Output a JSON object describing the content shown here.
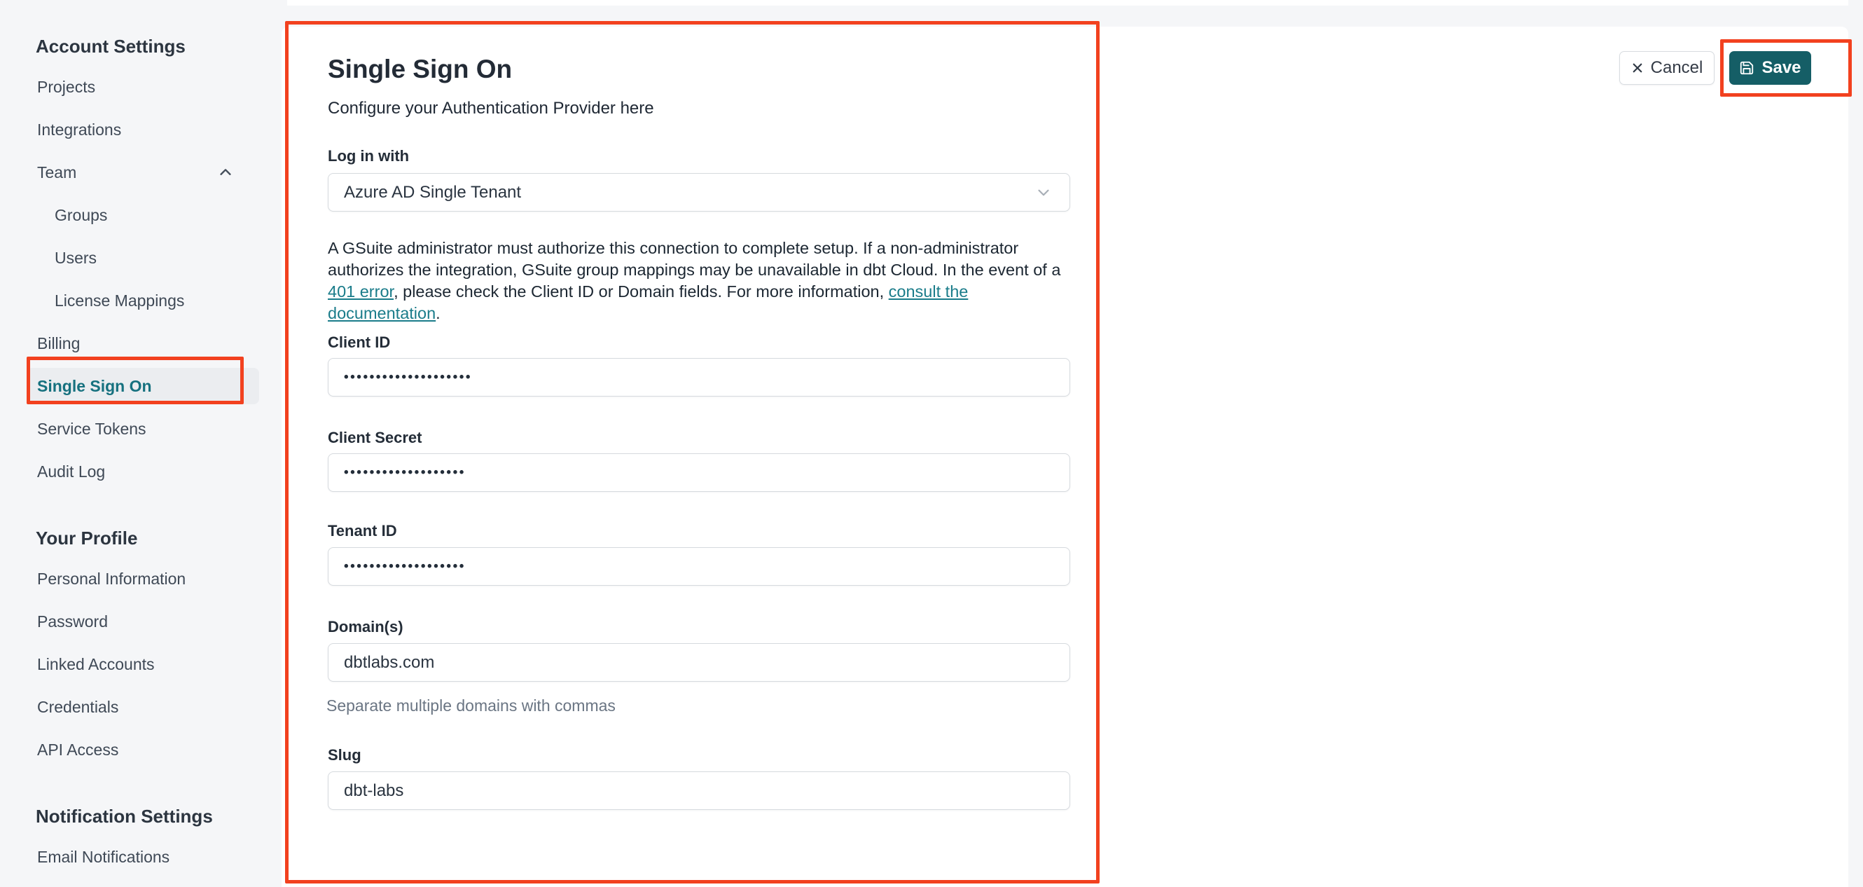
{
  "colors": {
    "annotation_red": "#f2411f",
    "save_button_teal": "#155e66",
    "link_teal": "#1a7c8a",
    "active_item_teal": "#16717f",
    "active_item_bg": "#ebedf0"
  },
  "icons": {
    "team_chevron": "chevron-up",
    "select_chevron": "chevron-down",
    "cancel": "x",
    "save": "floppy-disk"
  },
  "sidebar": {
    "sections": [
      {
        "heading": "Account Settings",
        "items": [
          {
            "label": "Projects"
          },
          {
            "label": "Integrations"
          },
          {
            "label": "Team"
          },
          {
            "label": "Groups"
          },
          {
            "label": "Users"
          },
          {
            "label": "License Mappings"
          },
          {
            "label": "Billing"
          },
          {
            "label": "Single Sign On"
          },
          {
            "label": "Service Tokens"
          },
          {
            "label": "Audit Log"
          }
        ]
      },
      {
        "heading": "Your Profile",
        "items": [
          {
            "label": "Personal Information"
          },
          {
            "label": "Password"
          },
          {
            "label": "Linked Accounts"
          },
          {
            "label": "Credentials"
          },
          {
            "label": "API Access"
          }
        ]
      },
      {
        "heading": "Notification Settings",
        "items": [
          {
            "label": "Email Notifications"
          }
        ]
      }
    ]
  },
  "main": {
    "title": "Single Sign On",
    "subtitle": "Configure your Authentication Provider here",
    "login_with": {
      "label": "Log in with",
      "value": "Azure AD Single Tenant"
    },
    "info": {
      "part1": "A GSuite administrator must authorize this connection to complete setup. If a non-administrator authorizes the integration, GSuite group mappings may be unavailable in dbt Cloud. In the event of a ",
      "link1": "401 error",
      "part2": ", please check the Client ID or Domain fields. For more information, ",
      "link2": "consult the documentation",
      "part3": "."
    },
    "fields": {
      "client_id": {
        "label": "Client ID",
        "value": "••••••••••••••••••••"
      },
      "client_secret": {
        "label": "Client Secret",
        "value": "•••••••••••••••••••"
      },
      "tenant_id": {
        "label": "Tenant ID",
        "value": "•••••••••••••••••••"
      },
      "domains": {
        "label": "Domain(s)",
        "value": "dbtlabs.com",
        "helper": "Separate multiple domains with commas"
      },
      "slug": {
        "label": "Slug",
        "value": "dbt-labs"
      }
    },
    "actions": {
      "cancel": "Cancel",
      "save": "Save"
    }
  }
}
